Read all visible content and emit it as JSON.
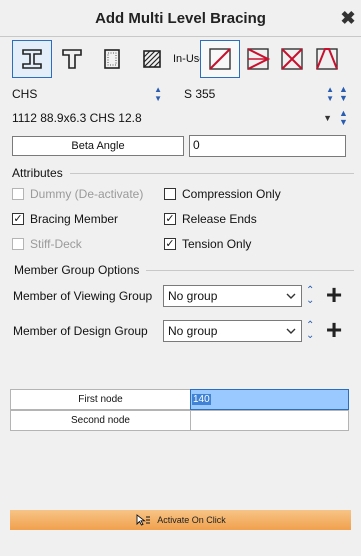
{
  "window": {
    "title": "Add Multi Level Bracing"
  },
  "toolbar": {
    "in_use_label": "In-Use",
    "section_icons": [
      "i-section-icon",
      "t-section-icon",
      "box-section-icon",
      "hatched-section-icon"
    ],
    "bracing_icons": [
      "single-diagonal-bracing-icon",
      "k-bracing-icon",
      "x-bracing-icon",
      "inverted-v-bracing-icon"
    ]
  },
  "profile": {
    "type": "CHS",
    "material": "S 355",
    "size": "1112 88.9x6.3 CHS 12.8"
  },
  "beta_angle": {
    "label": "Beta Angle",
    "value": "0"
  },
  "attributes": {
    "title": "Attributes",
    "dummy": {
      "label": "Dummy (De-activate)",
      "checked": false,
      "enabled": false
    },
    "compression_only": {
      "label": "Compression Only",
      "checked": false,
      "enabled": true
    },
    "bracing_member": {
      "label": "Bracing Member",
      "checked": true,
      "enabled": true
    },
    "release_ends": {
      "label": "Release Ends",
      "checked": true,
      "enabled": true
    },
    "stiff_deck": {
      "label": "Stiff-Deck",
      "checked": false,
      "enabled": false
    },
    "tension_only": {
      "label": "Tension Only",
      "checked": true,
      "enabled": true
    }
  },
  "member_groups": {
    "title": "Member Group Options",
    "viewing": {
      "label": "Member of Viewing Group",
      "value": "No group"
    },
    "design": {
      "label": "Member of Design Group",
      "value": "No group"
    }
  },
  "nodes": {
    "first": {
      "label": "First node",
      "value": "140"
    },
    "second": {
      "label": "Second node",
      "value": ""
    }
  },
  "activate": {
    "label": "Activate On Click"
  },
  "colors": {
    "accent": "#2a6ebd",
    "selection": "#99c9ff",
    "activate_bar": "#f0a14d",
    "bracing_red": "#c8102e"
  }
}
